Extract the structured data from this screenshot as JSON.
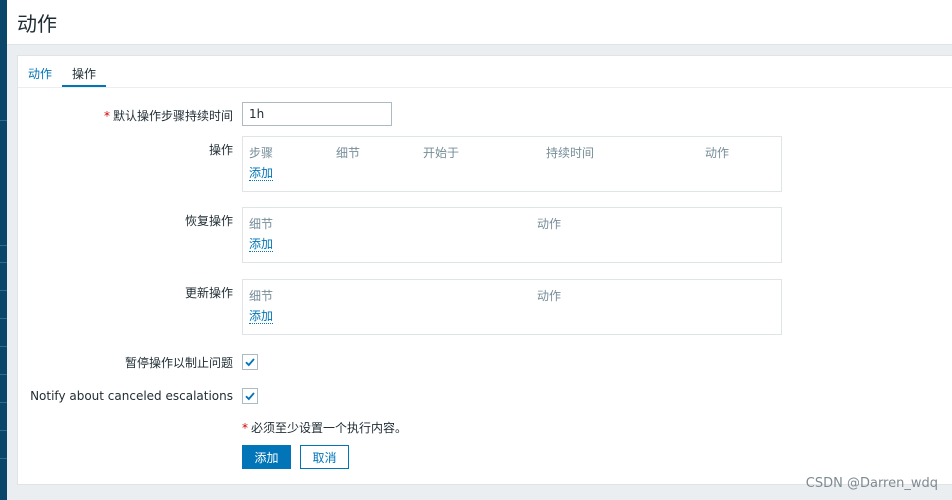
{
  "header": {
    "title": "动作"
  },
  "tabs": [
    {
      "label": "动作",
      "active": false
    },
    {
      "label": "操作",
      "active": true
    }
  ],
  "form": {
    "default_duration": {
      "label": "默认操作步骤持续时间",
      "value": "1h",
      "required": true
    },
    "operations": {
      "label": "操作",
      "columns": [
        "步骤",
        "细节",
        "开始于",
        "持续时间",
        "动作"
      ],
      "add_label": "添加"
    },
    "recovery_operations": {
      "label": "恢复操作",
      "columns": [
        "细节",
        "动作"
      ],
      "add_label": "添加"
    },
    "update_operations": {
      "label": "更新操作",
      "columns": [
        "细节",
        "动作"
      ],
      "add_label": "添加"
    },
    "pause_suppressed": {
      "label": "暂停操作以制止问题",
      "checked": true
    },
    "notify_canceled": {
      "label": "Notify about canceled escalations",
      "checked": true
    },
    "required_note": "必须至少设置一个执行内容。"
  },
  "buttons": {
    "add": "添加",
    "cancel": "取消"
  },
  "watermark": "CSDN @Darren_wdq",
  "colors": {
    "accent": "#0275b8",
    "required": "#d40000",
    "sidebar": "#0a466a"
  }
}
